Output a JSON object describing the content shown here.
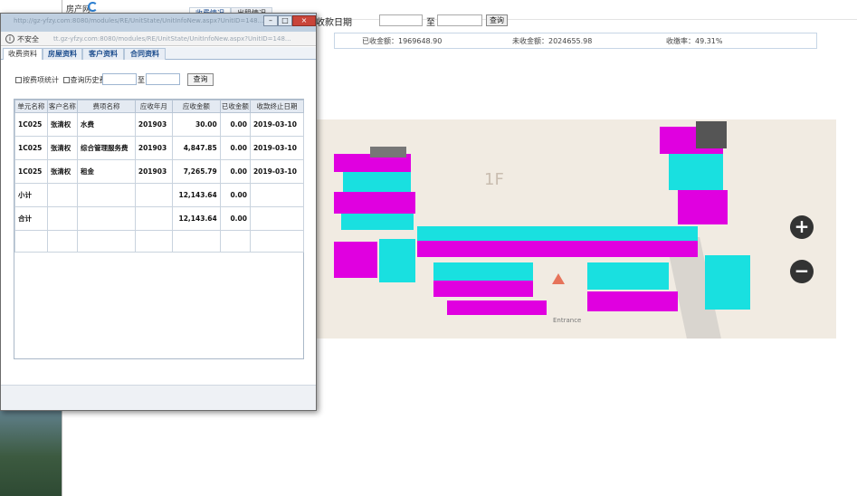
{
  "back_window": {
    "app_name": "房产网",
    "tabs": [
      {
        "label": "收费情况",
        "active": true
      },
      {
        "label": "出租情况",
        "active": false
      }
    ],
    "filter_label": "收款日期",
    "filter_to": "至",
    "query_label": "查询",
    "summary": {
      "received": "已收金额：1969648.90",
      "unreceived": "未收金额：2024655.98",
      "rate": "收缴率：49.31%"
    },
    "map": {
      "floor_label": "1F",
      "entrance_label": "Entrance",
      "zoom_in": "+",
      "zoom_out": "−"
    }
  },
  "popup": {
    "title": "http://gz-yfzy.com:8080/modules/RE/UnitState/UnitInfoNew.aspx?UnitID=148...",
    "insecure_label": "不安全",
    "url": "tt.gz-yfzy.com:8080/modules/RE/UnitState/UnitInfoNew.aspx?UnitID=148...",
    "tabs": [
      {
        "label": "收费资料",
        "active": true
      },
      {
        "label": "房屋资料",
        "active": false
      },
      {
        "label": "客户资料",
        "active": false
      },
      {
        "label": "合同资料",
        "active": false
      }
    ],
    "options": {
      "by_item": "按费项统计",
      "history": "查询历史费用",
      "to": "至",
      "query_button": "查询"
    },
    "table": {
      "headers": [
        "单元名称",
        "客户名称",
        "费项名称",
        "应收年月",
        "应收金额",
        "已收金额",
        "收款终止日期"
      ],
      "rows": [
        [
          "1C025",
          "张清权",
          "水费",
          "201903",
          "30.00",
          "0.00",
          "2019-03-10"
        ],
        [
          "1C025",
          "张清权",
          "综合管理服务费",
          "201903",
          "4,847.85",
          "0.00",
          "2019-03-10"
        ],
        [
          "1C025",
          "张清权",
          "租金",
          "201903",
          "7,265.79",
          "0.00",
          "2019-03-10"
        ],
        [
          "小计",
          "",
          "",
          "",
          "12,143.64",
          "0.00",
          ""
        ],
        [
          "合计",
          "",
          "",
          "",
          "12,143.64",
          "0.00",
          ""
        ]
      ]
    }
  }
}
